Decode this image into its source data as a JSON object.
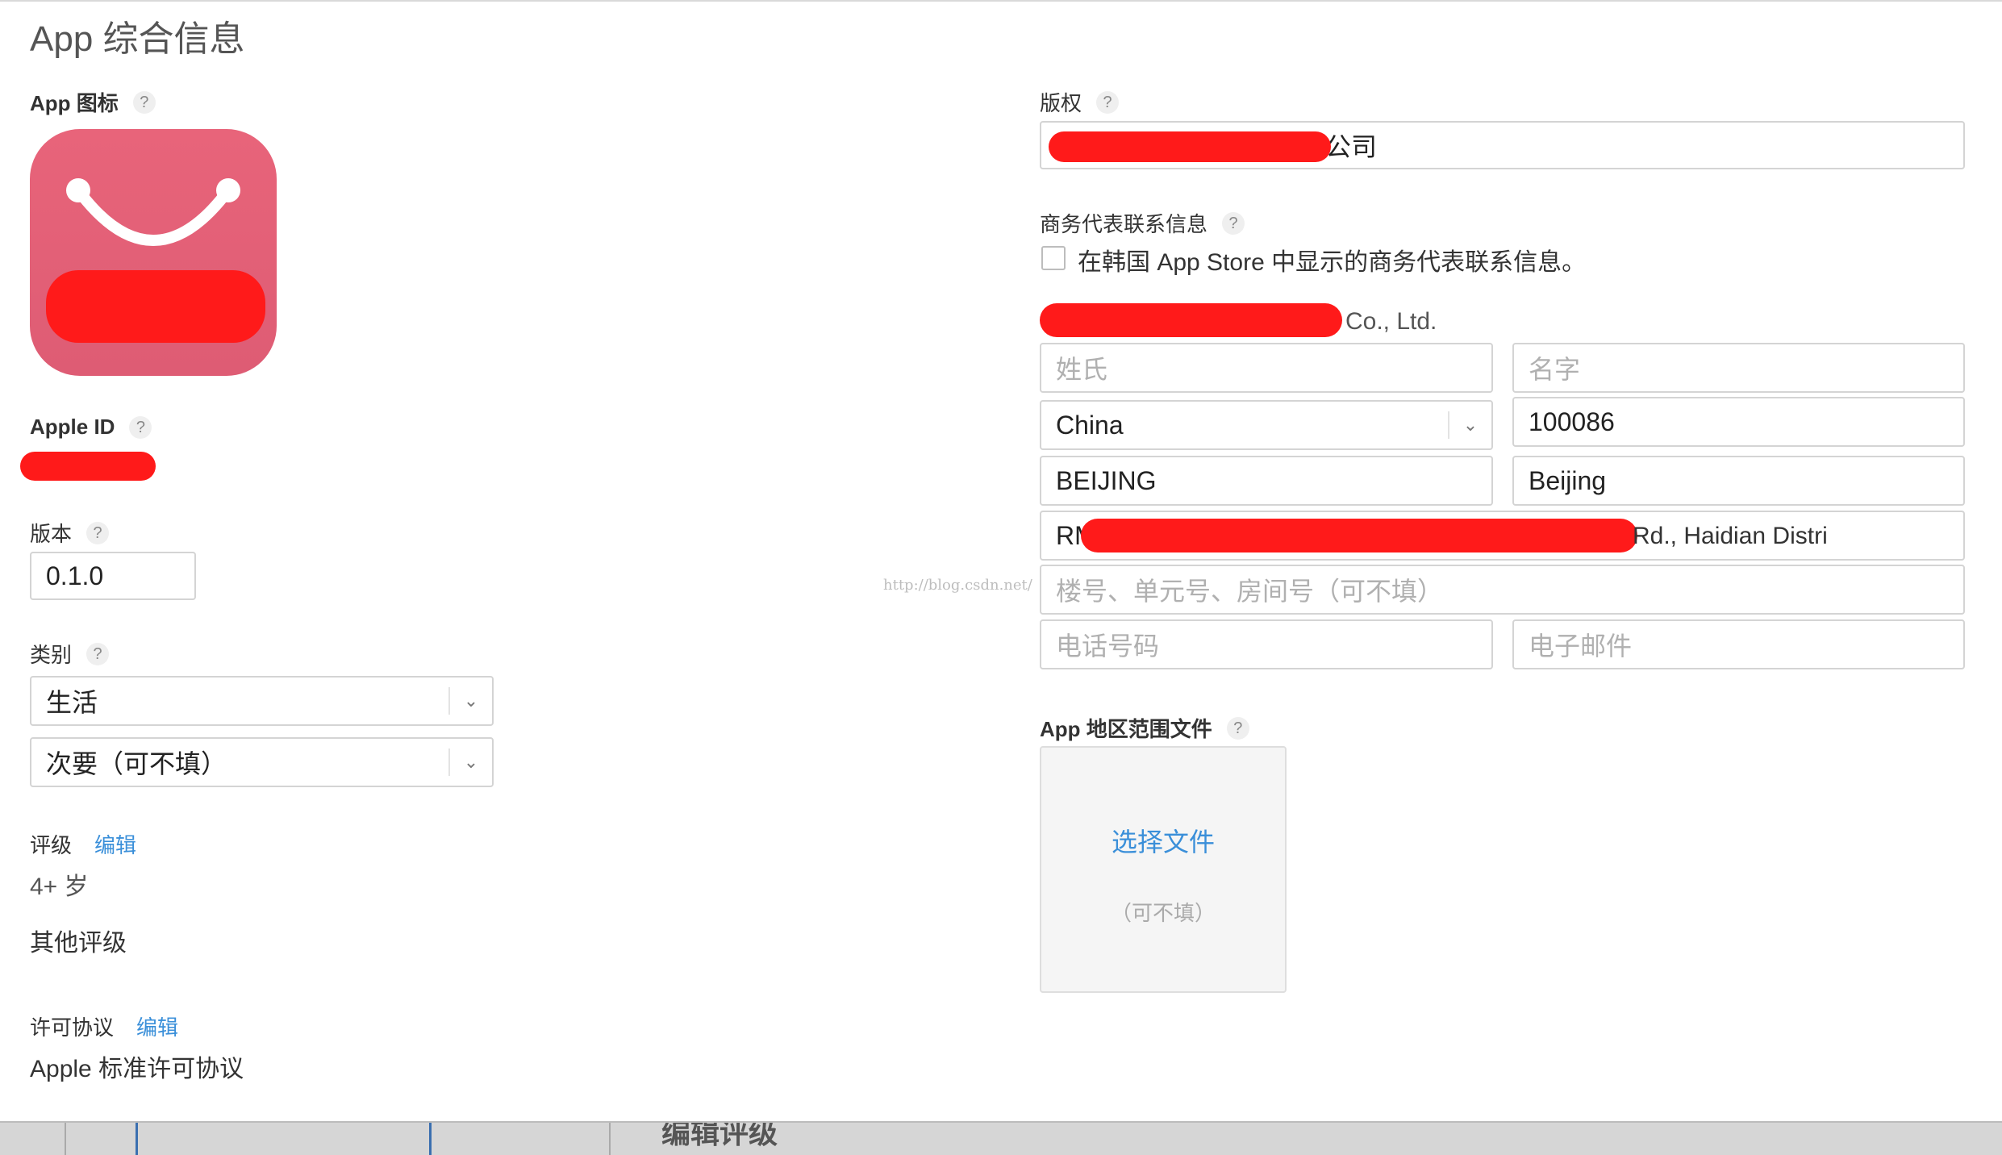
{
  "page": {
    "title": "App 综合信息"
  },
  "left": {
    "icon_label": "App 图标",
    "apple_id_label": "Apple ID",
    "version_label": "版本",
    "version_value": "0.1.0",
    "category_label": "类别",
    "primary_category": "生活",
    "secondary_category": "次要（可不填）",
    "rating_label": "评级",
    "rating_edit": "编辑",
    "rating_value": "4+ 岁",
    "other_ratings": "其他评级",
    "license_label": "许可协议",
    "license_edit": "编辑",
    "license_link": "Apple 标准许可协议"
  },
  "right": {
    "copyright_label": "版权",
    "copyright_value": "有限公司",
    "contact_label": "商务代表联系信息",
    "korea_checkbox_label": "在韩国 App Store 中显示的商务代表联系信息。",
    "company_suffix": "Co., Ltd.",
    "last_name_placeholder": "姓氏",
    "first_name_placeholder": "名字",
    "country_value": "China",
    "postal_code": "100086",
    "state_value": "BEIJING",
    "city_value": "Beijing",
    "address_prefix": "RM",
    "address_suffix": "Rd., Haidian Distri",
    "address2_placeholder": "楼号、单元号、房间号（可不填）",
    "phone_placeholder": "电话号码",
    "email_placeholder": "电子邮件",
    "region_file_label": "App 地区范围文件",
    "choose_file": "选择文件",
    "choose_file_optional": "（可不填）"
  },
  "watermark": "http://blog.csdn.net/",
  "bottom": {
    "partial_title": "编辑评级"
  },
  "help_glyph": "?",
  "icons": {
    "help": "question-circle-icon",
    "select_arrow": "chevron-down-icon",
    "app_icon": "shopping-bag-smile-icon"
  },
  "colors": {
    "link": "#3a8fd9",
    "app_icon": "#e4607a",
    "redaction": "#ff1a1a"
  }
}
